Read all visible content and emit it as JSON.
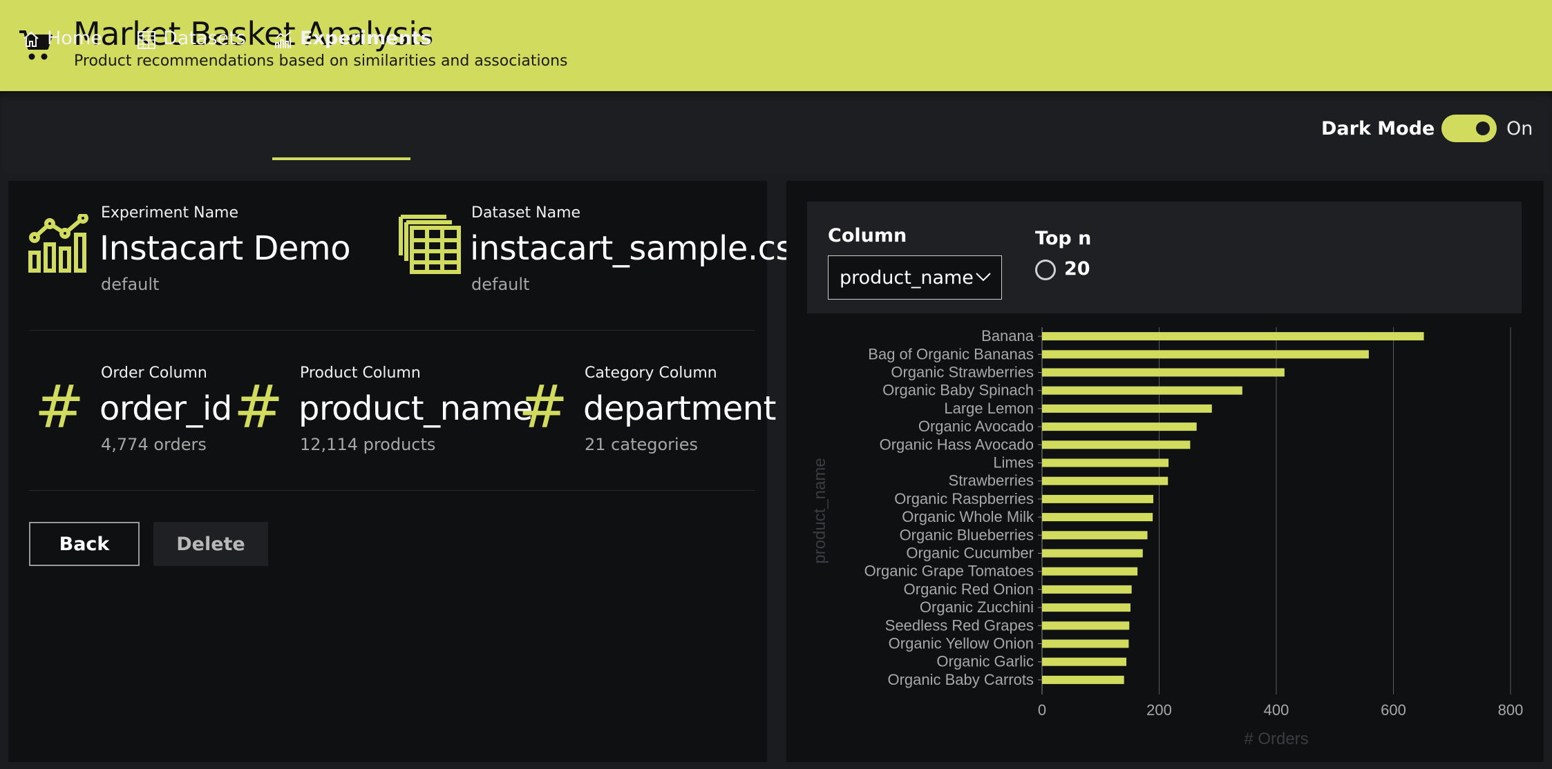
{
  "header": {
    "title": "Market Basket Analysis",
    "subtitle": "Product recommendations based on similarities and associations",
    "icon": "cart-icon"
  },
  "nav": {
    "items": [
      {
        "label": "Home",
        "icon": "home-icon"
      },
      {
        "label": "Datasets",
        "icon": "table-icon"
      },
      {
        "label": "Experiments",
        "icon": "chart-icon",
        "active": true
      }
    ],
    "dark_mode_label": "Dark Mode",
    "dark_mode_state": "On",
    "dark_mode_on": true
  },
  "experiment": {
    "name_label": "Experiment Name",
    "name": "Instacart Demo",
    "name_sub": "default",
    "dataset_label": "Dataset Name",
    "dataset": "instacart_sample.csv",
    "dataset_sub": "default",
    "order_label": "Order Column",
    "order_value": "order_id",
    "order_sub": "4,774 orders",
    "product_label": "Product Column",
    "product_value": "product_name",
    "product_sub": "12,114 products",
    "category_label": "Category Column",
    "category_value": "department",
    "category_sub": "21 categories",
    "hash_glyph": "#",
    "back_label": "Back",
    "delete_label": "Delete"
  },
  "controls": {
    "column_label": "Column",
    "column_value": "product_name",
    "topn_label": "Top n",
    "topn_value": "20"
  },
  "colors": {
    "accent": "#d1dc5e",
    "background": "#1b1c1f",
    "panel": "#0f1012"
  },
  "chart_data": {
    "type": "bar",
    "orientation": "horizontal",
    "categories": [
      "Banana",
      "Bag of Organic Bananas",
      "Organic Strawberries",
      "Organic Baby Spinach",
      "Large Lemon",
      "Organic Avocado",
      "Organic Hass Avocado",
      "Limes",
      "Strawberries",
      "Organic Raspberries",
      "Organic Whole Milk",
      "Organic Blueberries",
      "Organic Cucumber",
      "Organic Grape Tomatoes",
      "Organic Red Onion",
      "Organic Zucchini",
      "Seedless Red Grapes",
      "Organic Yellow Onion",
      "Organic Garlic",
      "Organic Baby Carrots"
    ],
    "values": [
      652,
      558,
      414,
      342,
      290,
      264,
      253,
      216,
      215,
      190,
      189,
      180,
      172,
      163,
      153,
      151,
      149,
      148,
      144,
      140
    ],
    "xlabel": "# Orders",
    "ylabel": "product_name",
    "xlim": [
      0,
      800
    ],
    "xticks": [
      0,
      200,
      400,
      600,
      800
    ],
    "grid": true,
    "bar_color": "#d1dc5e"
  }
}
